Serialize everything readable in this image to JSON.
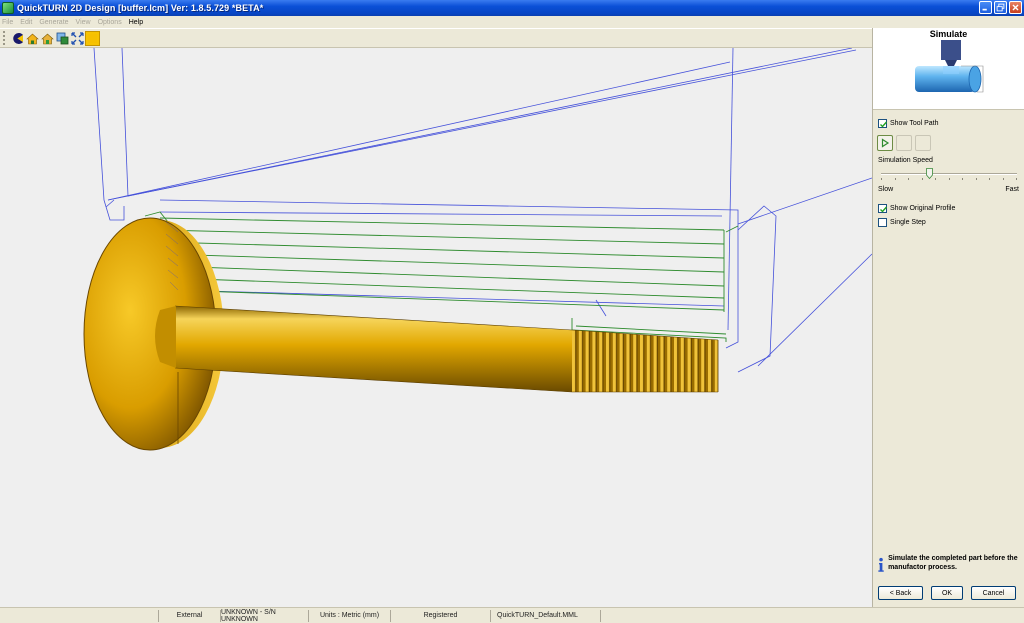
{
  "window": {
    "title": "QuickTURN 2D Design [buffer.lcm] Ver: 1.8.5.729 *BETA*"
  },
  "menu": {
    "items": [
      {
        "label": "File",
        "enabled": false
      },
      {
        "label": "Edit",
        "enabled": false
      },
      {
        "label": "Generate",
        "enabled": false
      },
      {
        "label": "View",
        "enabled": false
      },
      {
        "label": "Options",
        "enabled": false
      },
      {
        "label": "Help",
        "enabled": true
      }
    ]
  },
  "toolbar": {
    "buttons": [
      {
        "icon": "pacman-icon"
      },
      {
        "icon": "home-up-icon"
      },
      {
        "icon": "home-green-icon"
      },
      {
        "icon": "window-zoom-icon"
      },
      {
        "icon": "fit-view-icon"
      },
      {
        "icon": "shaded-square-icon",
        "selected": true
      }
    ]
  },
  "panel": {
    "title": "Simulate",
    "show_tool_path": {
      "label": "Show Tool Path",
      "checked": true
    },
    "speed_label": "Simulation Speed",
    "speed_level": 0.36,
    "slow_label": "Slow",
    "fast_label": "Fast",
    "show_original_profile": {
      "label": "Show Original Profile",
      "checked": true
    },
    "single_step": {
      "label": "Single Step",
      "checked": false
    },
    "info_text": "Simulate the completed part before the manufactor process.",
    "back_label": "< Back",
    "ok_label": "OK",
    "cancel_label": "Cancel"
  },
  "status": {
    "mode": "External",
    "serial": "UNKNOWN - S/N UNKNOWN",
    "units": "Units : Metric (mm)",
    "registration": "Registered",
    "machine_file": "QuickTURN_Default.MML"
  },
  "colors": {
    "toolpath": "#3340d8",
    "profile": "#2e8b2e",
    "part": "#e7b000",
    "titlebar": "#0a4fd6"
  }
}
